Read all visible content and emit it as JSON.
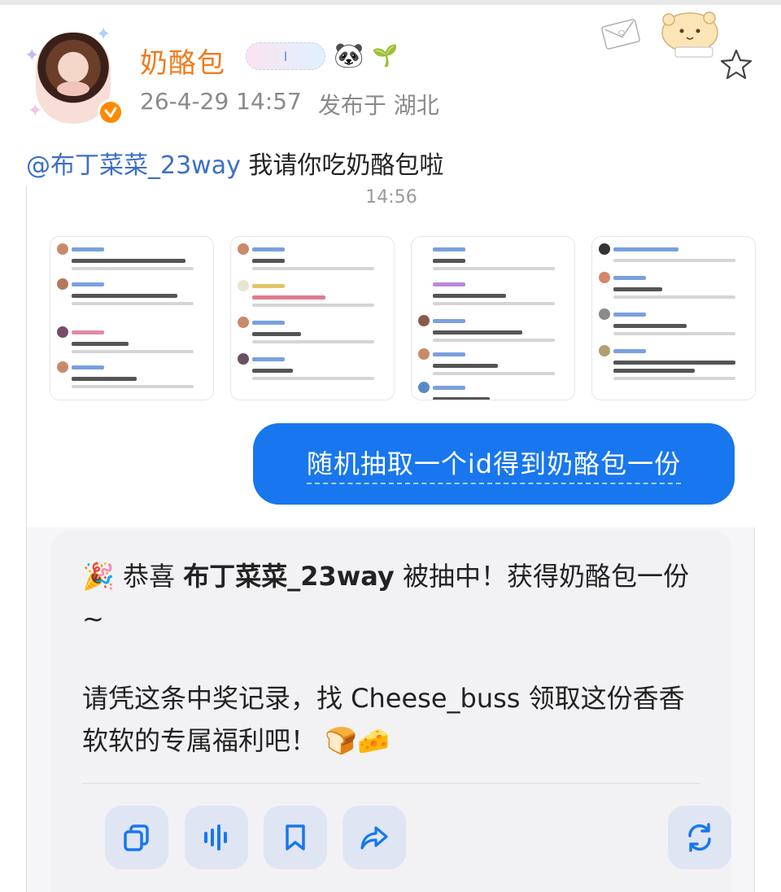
{
  "post": {
    "username": "奶酪包",
    "badge_text": "I",
    "panda_icon": "🐼",
    "sprout_icon": "🌱",
    "date": "26-4-29 14:57",
    "location": "发布于 湖北",
    "mention": "@布丁菜菜_23way",
    "text": " 我请你吃奶酪包啦"
  },
  "screenshot": {
    "time": "14:56",
    "bubble": "随机抽取一个id得到奶酪包一份",
    "result": {
      "party_icon": "🎉",
      "congrats": "恭喜 ",
      "winner": "布丁菜菜_23way",
      "line1_rest": " 被抽中！获得奶酪包一份~",
      "line2": "请凭这条中奖记录，找 Cheese_buss 领取这份香香软软的专属福利吧！",
      "bread_icon": "🍞",
      "cheese_icon": "🧀"
    },
    "actions": [
      "copy-icon",
      "voice-icon",
      "bookmark-icon",
      "share-icon",
      "refresh-icon"
    ]
  },
  "colors": {
    "accent": "#1877ee",
    "username": "#f07b1d",
    "mention": "#3b6fc7",
    "verify": "#ff8a00"
  }
}
